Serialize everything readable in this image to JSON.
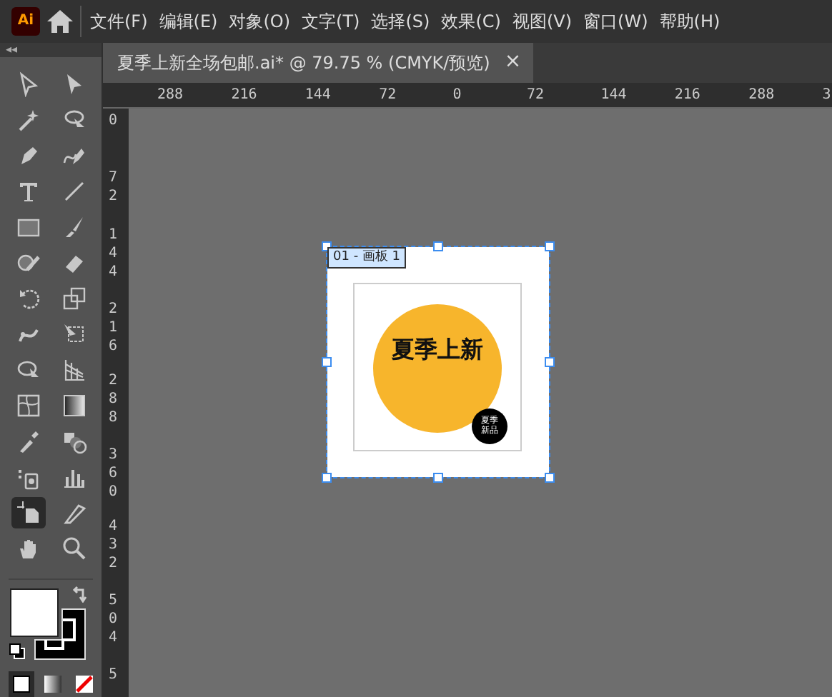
{
  "menubar": {
    "app_icon": "Ai",
    "menus": [
      "文件(F)",
      "编辑(E)",
      "对象(O)",
      "文字(T)",
      "选择(S)",
      "效果(C)",
      "视图(V)",
      "窗口(W)",
      "帮助(H)"
    ]
  },
  "panel_header": {
    "collapse": "◂◂"
  },
  "document_tab": {
    "title": "夏季上新全场包邮.ai* @ 79.75 % (CMYK/预览)",
    "close": "×"
  },
  "horizontal_ruler": [
    "288",
    "216",
    "144",
    "72",
    "0",
    "72",
    "144",
    "216",
    "288",
    "3"
  ],
  "vertical_ruler": [
    "0",
    "72",
    "144",
    "216",
    "288",
    "360",
    "432",
    "504",
    "5"
  ],
  "tools": [
    {
      "selected": false
    },
    {
      "selected": false
    },
    {
      "selected": false
    },
    {
      "selected": false
    },
    {
      "selected": false
    },
    {
      "selected": false
    },
    {
      "selected": false
    },
    {
      "selected": false
    },
    {
      "selected": false
    },
    {
      "selected": false
    },
    {
      "selected": false
    },
    {
      "selected": false
    },
    {
      "selected": false
    },
    {
      "selected": false
    },
    {
      "selected": false
    },
    {
      "selected": false
    },
    {
      "selected": false
    },
    {
      "selected": false
    },
    {
      "selected": false
    },
    {
      "selected": false
    },
    {
      "selected": false
    },
    {
      "selected": false
    },
    {
      "selected": false
    },
    {
      "selected": false
    },
    {
      "selected": true
    },
    {
      "selected": false
    },
    {
      "selected": false
    },
    {
      "selected": false
    }
  ],
  "artboard": {
    "label": "01 - 画板 1",
    "headline": "夏季上新",
    "badge": "夏季新品"
  }
}
